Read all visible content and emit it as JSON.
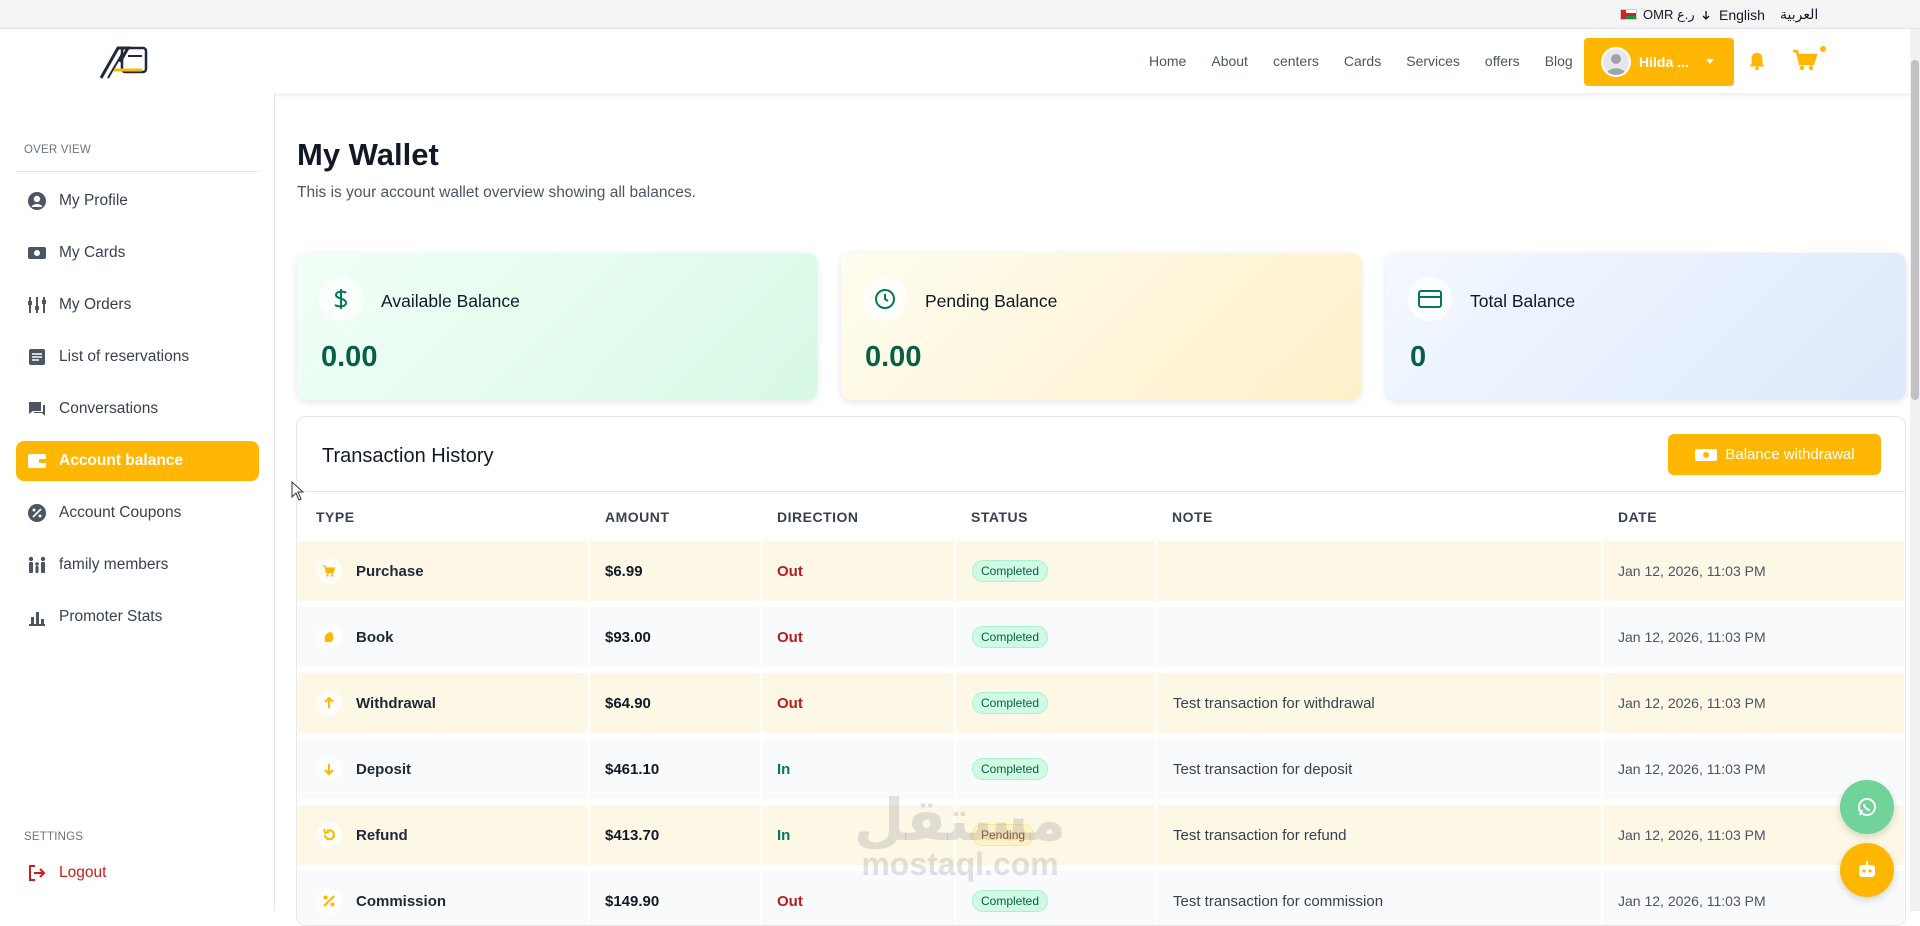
{
  "topbar": {
    "currency": "OMR ر.ع",
    "lang_en": "English",
    "lang_ar": "العربية"
  },
  "header": {
    "nav": [
      "Home",
      "About",
      "centers",
      "Cards",
      "Services",
      "offers",
      "Blog"
    ],
    "user_name": "Hilda ..."
  },
  "sidebar": {
    "overview_label": "OVER VIEW",
    "items": [
      {
        "label": "My Profile",
        "icon": "user-circle-icon"
      },
      {
        "label": "My Cards",
        "icon": "card-icon"
      },
      {
        "label": "My Orders",
        "icon": "orders-icon"
      },
      {
        "label": "List of reservations",
        "icon": "list-icon"
      },
      {
        "label": "Conversations",
        "icon": "chat-icon"
      },
      {
        "label": "Account balance",
        "icon": "wallet-icon"
      },
      {
        "label": "Account Coupons",
        "icon": "coupon-icon"
      },
      {
        "label": "family members",
        "icon": "family-icon"
      },
      {
        "label": "Promoter Stats",
        "icon": "stats-icon"
      }
    ],
    "settings_label": "SETTINGS",
    "logout_label": "Logout"
  },
  "main": {
    "title": "My Wallet",
    "subtitle": "This is your account wallet overview showing all balances.",
    "cards": [
      {
        "label": "Available Balance",
        "value": "0.00",
        "icon": "dollar-icon"
      },
      {
        "label": "Pending Balance",
        "value": "0.00",
        "icon": "clock-icon"
      },
      {
        "label": "Total Balance",
        "value": "0",
        "icon": "credit-card-icon"
      }
    ],
    "history": {
      "title": "Transaction History",
      "withdraw_label": "Balance withdrawal",
      "columns": [
        "TYPE",
        "AMOUNT",
        "DIRECTION",
        "STATUS",
        "NOTE",
        "DATE"
      ],
      "rows": [
        {
          "type": "Purchase",
          "amount": "$6.99",
          "direction": "Out",
          "status": "Completed",
          "note": "",
          "date": "Jan 12, 2026, 11:03 PM",
          "icon": "cart-icon"
        },
        {
          "type": "Book",
          "amount": "$93.00",
          "direction": "Out",
          "status": "Completed",
          "note": "",
          "date": "Jan 12, 2026, 11:03 PM",
          "icon": "hand-icon"
        },
        {
          "type": "Withdrawal",
          "amount": "$64.90",
          "direction": "Out",
          "status": "Completed",
          "note": "Test transaction for withdrawal",
          "date": "Jan 12, 2026, 11:03 PM",
          "icon": "arrow-up-icon"
        },
        {
          "type": "Deposit",
          "amount": "$461.10",
          "direction": "In",
          "status": "Completed",
          "note": "Test transaction for deposit",
          "date": "Jan 12, 2026, 11:03 PM",
          "icon": "arrow-down-icon"
        },
        {
          "type": "Refund",
          "amount": "$413.70",
          "direction": "In",
          "status": "Pending",
          "note": "Test transaction for refund",
          "date": "Jan 12, 2026, 11:03 PM",
          "icon": "undo-icon"
        },
        {
          "type": "Commission",
          "amount": "$149.90",
          "direction": "Out",
          "status": "Completed",
          "note": "Test transaction for commission",
          "date": "Jan 12, 2026, 11:03 PM",
          "icon": "percent-icon"
        }
      ]
    }
  },
  "watermark": {
    "ar": "مستقل",
    "en": "mostaql.com"
  },
  "colors": {
    "accent": "#ffb703",
    "success": "#047857",
    "danger": "#b91c1c"
  }
}
